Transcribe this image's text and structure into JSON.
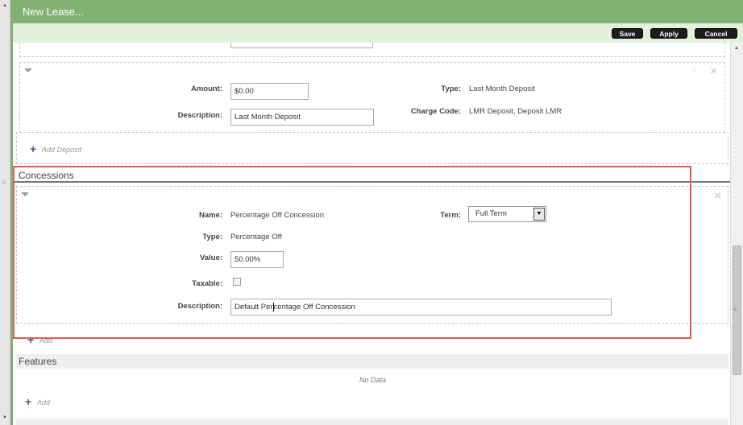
{
  "window": {
    "title": "New Lease..."
  },
  "toolbar": {
    "save_label": "Save",
    "apply_label": "Apply",
    "cancel_label": "Cancel"
  },
  "deposit": {
    "amount_label": "Amount:",
    "amount_value": "$0.00",
    "description_label": "Description:",
    "description_value": "Last Month Deposit",
    "type_label": "Type:",
    "type_value": "Last Month Deposit",
    "charge_code_label": "Charge Code:",
    "charge_code_value": "LMR Deposit, Deposit LMR",
    "add_label": "Add Deposit"
  },
  "concessions": {
    "header": "Concessions",
    "name_label": "Name:",
    "name_value": "Percentage Off Concession",
    "term_label": "Term:",
    "term_value": "Full Term",
    "type_label": "Type:",
    "type_value": "Percentage Off",
    "value_label": "Value:",
    "value_value": "50.00%",
    "taxable_label": "Taxable:",
    "taxable_checked": false,
    "description_label": "Description:",
    "description_value_before": "Default Per",
    "description_value_after": "centage Off Concession",
    "add_label": "Add"
  },
  "features": {
    "header": "Features",
    "empty_text": "No Data",
    "add_label": "Add"
  },
  "icons": {
    "collapse": "triangle-down-icon",
    "remove": "close-icon",
    "move": "arrow-up-icon",
    "add": "plus-icon"
  },
  "colors": {
    "titlebar": "#82b273",
    "toolbar": "#e3f0dc",
    "highlight": "#e05a5a",
    "plus": "#3c5a8c"
  }
}
